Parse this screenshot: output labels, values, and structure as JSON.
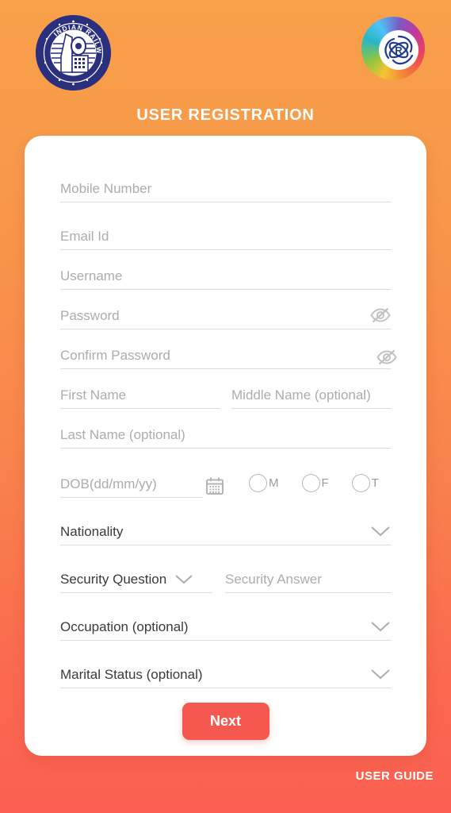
{
  "header": {
    "title": "USER REGISTRATION",
    "logo_left_name": "indian-railways-logo",
    "logo_left_text": "INDIAN RAILWAYS",
    "logo_right_name": "irctc-logo"
  },
  "colors": {
    "background_top": "#F8A04A",
    "background_bottom": "#FB5F51",
    "card": "#FFFFFF",
    "accent_button": "#F4584F",
    "placeholder_text": "#ACACAC",
    "value_text": "#3A3A3A",
    "underline": "#DCDCDC",
    "railways_blue": "#2A2F7E"
  },
  "form": {
    "mobile": {
      "placeholder": "Mobile Number",
      "value": ""
    },
    "email": {
      "placeholder": "Email Id",
      "value": ""
    },
    "username": {
      "placeholder": "Username",
      "value": ""
    },
    "password": {
      "placeholder": "Password",
      "value": "",
      "toggle_icon": "eye-off-icon"
    },
    "confirm_password": {
      "placeholder": "Confirm Password",
      "value": "",
      "toggle_icon": "eye-off-icon"
    },
    "first_name": {
      "placeholder": "First Name",
      "value": ""
    },
    "middle_name": {
      "placeholder": "Middle Name (optional)",
      "value": ""
    },
    "last_name": {
      "placeholder": "Last Name (optional)",
      "value": ""
    },
    "dob": {
      "placeholder": "DOB(dd/mm/yy)",
      "value": "",
      "icon": "calendar-icon"
    },
    "gender": {
      "options": [
        {
          "label": "M",
          "selected": false
        },
        {
          "label": "F",
          "selected": false
        },
        {
          "label": "T",
          "selected": false
        }
      ]
    },
    "nationality": {
      "label": "Nationality",
      "icon": "chevron-down-icon"
    },
    "security_question": {
      "label": "Security Question",
      "icon": "chevron-down-icon"
    },
    "security_answer": {
      "placeholder": "Security Answer",
      "value": ""
    },
    "occupation": {
      "label": "Occupation (optional)",
      "icon": "chevron-down-icon"
    },
    "marital_status": {
      "label": "Marital Status (optional)",
      "icon": "chevron-down-icon"
    },
    "submit": {
      "label": "Next"
    }
  },
  "footer": {
    "user_guide": "USER GUIDE"
  }
}
